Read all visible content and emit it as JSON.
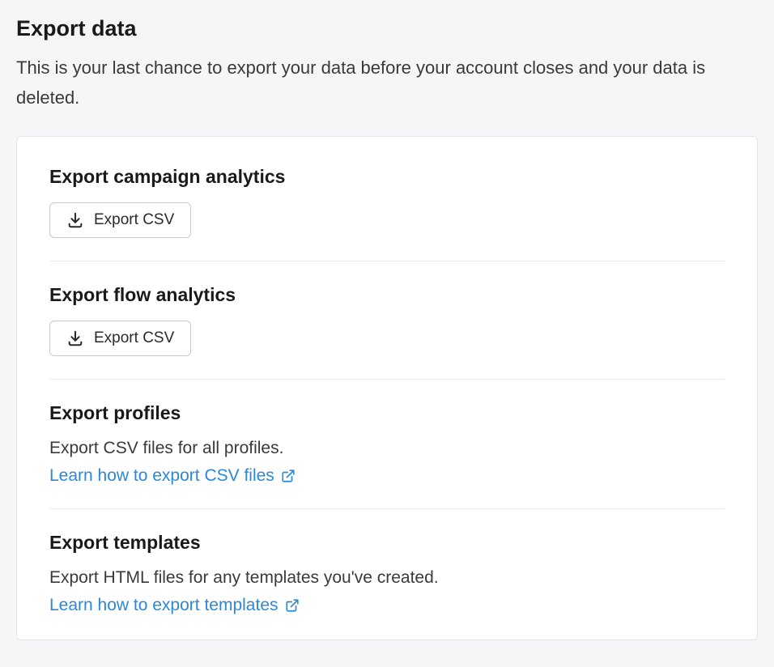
{
  "page": {
    "title": "Export data",
    "subtitle": "This is your last chance to export your data before your account closes and your data is deleted."
  },
  "sections": {
    "campaign": {
      "title": "Export campaign analytics",
      "button_label": "Export CSV"
    },
    "flow": {
      "title": "Export flow analytics",
      "button_label": "Export CSV"
    },
    "profiles": {
      "title": "Export profiles",
      "description": "Export CSV files for all profiles.",
      "link_label": "Learn how to export CSV files"
    },
    "templates": {
      "title": "Export templates",
      "description": "Export HTML files for any templates you've created.",
      "link_label": "Learn how to export templates"
    }
  }
}
